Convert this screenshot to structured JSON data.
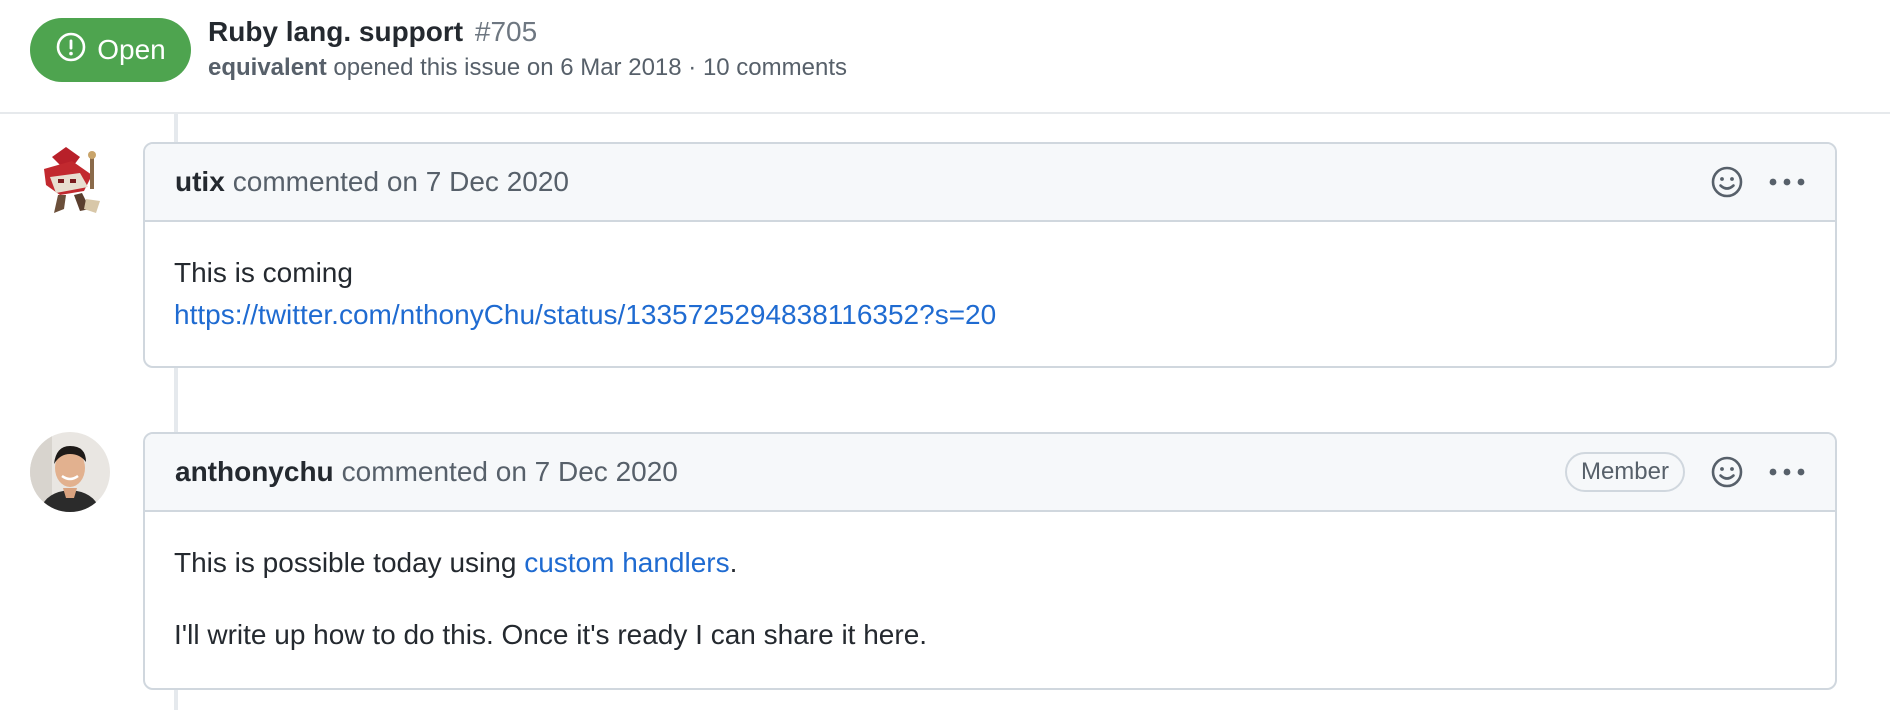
{
  "issue": {
    "state": "Open",
    "title": "Ruby lang. support",
    "number": "#705",
    "author": "equivalent",
    "meta_text": "opened this issue on 6 Mar 2018 · 10 comments"
  },
  "comments": [
    {
      "author": "utix",
      "action": "commented on 7 Dec 2020",
      "role": "",
      "body_line1": "This is coming",
      "link": "https://twitter.com/nthonyChu/status/1335725294838116352?s=20"
    },
    {
      "author": "anthonychu",
      "action": "commented on 7 Dec 2020",
      "role": "Member",
      "body_prefix": "This is possible today using ",
      "link_text": "custom handlers",
      "body_suffix": ".",
      "body_line2": "I'll write up how to do this. Once it's ready I can share it here."
    }
  ],
  "colors": {
    "open_green": "#4ea44f",
    "link_blue": "#1f6bd1",
    "header_bg": "#f6f8fa",
    "border": "#d0d7de"
  },
  "icons": {
    "state": "issue-opened-icon",
    "reaction": "smiley-icon",
    "more": "kebab-horizontal-icon"
  }
}
